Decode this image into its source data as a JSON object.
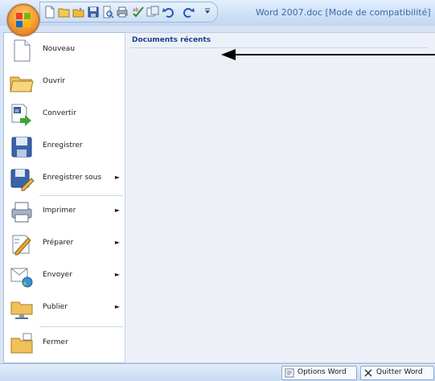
{
  "window": {
    "title": "Word 2007.doc [Mode de compatibilité]"
  },
  "quick_access": [
    {
      "icon": "new-document-icon"
    },
    {
      "icon": "open-folder-icon"
    },
    {
      "icon": "open-icon"
    },
    {
      "icon": "save-icon"
    },
    {
      "icon": "print-preview-icon"
    },
    {
      "icon": "print-icon"
    },
    {
      "icon": "spelling-icon"
    },
    {
      "icon": "research-icon"
    },
    {
      "icon": "undo-icon"
    },
    {
      "icon": "redo-icon"
    },
    {
      "icon": "customize-dropdown-icon"
    }
  ],
  "office_menu": {
    "items": [
      {
        "label": "Nouveau",
        "icon": "new-document-icon",
        "submenu": false
      },
      {
        "label": "Ouvrir",
        "icon": "open-folder-icon",
        "submenu": false
      },
      {
        "label": "Convertir",
        "icon": "convert-icon",
        "submenu": false
      },
      {
        "label": "Enregistrer",
        "icon": "save-icon",
        "submenu": false
      },
      {
        "label": "Enregistrer sous",
        "icon": "save-as-icon",
        "submenu": true
      },
      {
        "label": "Imprimer",
        "icon": "printer-icon",
        "submenu": true
      },
      {
        "label": "Préparer",
        "icon": "prepare-icon",
        "submenu": true
      },
      {
        "label": "Envoyer",
        "icon": "send-icon",
        "submenu": true
      },
      {
        "label": "Publier",
        "icon": "publish-icon",
        "submenu": true
      },
      {
        "label": "Fermer",
        "icon": "close-folder-icon",
        "submenu": false
      }
    ],
    "submenu_arrow": "►"
  },
  "recent_documents": {
    "header": "Documents récents"
  },
  "footer": {
    "options_label": "Options Word",
    "quit_label": "Quitter Word"
  },
  "colors": {
    "ribbon_blue": "#d7e4f5",
    "header_text": "#15428b",
    "office_orange": "#f7a13a"
  }
}
